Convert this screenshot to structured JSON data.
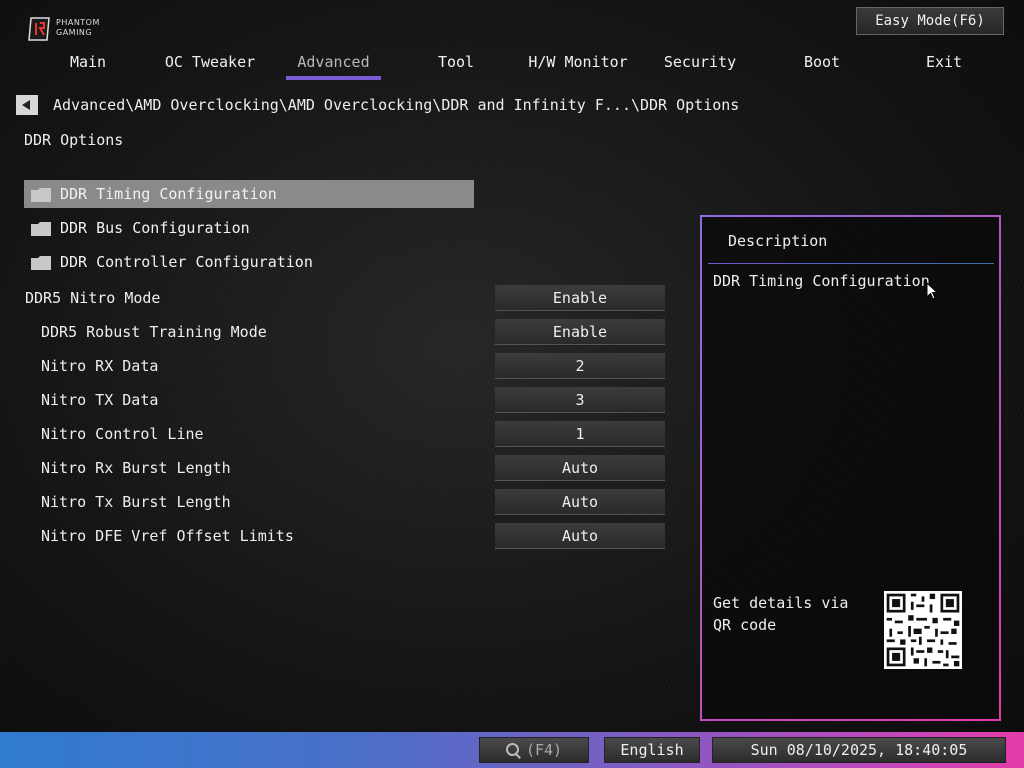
{
  "brand": {
    "line1": "PHANTOM",
    "line2": "GAMING"
  },
  "header": {
    "easy_mode_label": "Easy Mode(F6)"
  },
  "tabs": [
    {
      "label": "Main"
    },
    {
      "label": "OC Tweaker"
    },
    {
      "label": "Advanced"
    },
    {
      "label": "Tool"
    },
    {
      "label": "H/W Monitor"
    },
    {
      "label": "Security"
    },
    {
      "label": "Boot"
    },
    {
      "label": "Exit"
    }
  ],
  "active_tab": "Advanced",
  "breadcrumb": "Advanced\\AMD Overclocking\\AMD Overclocking\\DDR and Infinity F...\\DDR Options",
  "page_title": "DDR Options",
  "submenus": [
    {
      "label": "DDR Timing Configuration",
      "selected": true
    },
    {
      "label": "DDR Bus Configuration"
    },
    {
      "label": "DDR Controller Configuration"
    }
  ],
  "settings": [
    {
      "label": "DDR5 Nitro Mode",
      "value": "Enable"
    },
    {
      "label": "DDR5 Robust Training Mode",
      "value": "Enable"
    },
    {
      "label": "Nitro RX Data",
      "value": "2"
    },
    {
      "label": "Nitro TX Data",
      "value": "3"
    },
    {
      "label": "Nitro Control Line",
      "value": "1"
    },
    {
      "label": "Nitro Rx Burst Length",
      "value": "Auto"
    },
    {
      "label": "Nitro Tx Burst Length",
      "value": "Auto"
    },
    {
      "label": "Nitro DFE Vref Offset Limits",
      "value": "Auto"
    }
  ],
  "description": {
    "title": "Description",
    "text": "DDR Timing Configuration",
    "qr_text": "Get details via QR code"
  },
  "footer": {
    "search_hint": "(F4)",
    "language": "English",
    "datetime": "Sun 08/10/2025, 18:40:05"
  },
  "colors": {
    "accent": "#7a5cd6",
    "selected_row": "#8a8a8a",
    "footer_left": "#2f7bd0",
    "footer_right": "#e43ca8"
  },
  "icons": [
    "asrock-logo-icon",
    "back-arrow-icon",
    "folder-icon",
    "search-icon",
    "qr-code-icon",
    "mouse-cursor-icon"
  ]
}
